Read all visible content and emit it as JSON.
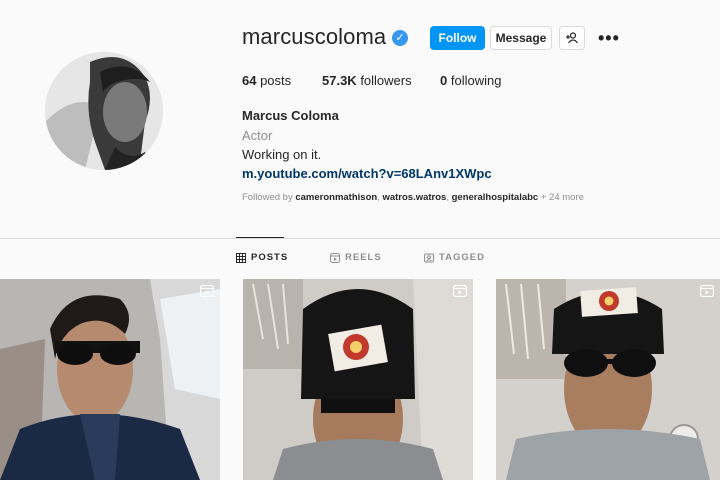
{
  "profile": {
    "username": "marcuscoloma",
    "verified": true,
    "actions": {
      "follow": "Follow",
      "message": "Message",
      "suggest": "+",
      "more": "•••"
    },
    "stats": [
      {
        "value": "64",
        "label": " posts"
      },
      {
        "value": "57.3K",
        "label": " followers"
      },
      {
        "value": "0",
        "label": " following"
      }
    ],
    "full_name": "Marcus Coloma",
    "category": "Actor",
    "bio": "Working on it.",
    "link": "m.youtube.com/watch?v=68LAnv1XWpc",
    "followed_by": {
      "prefix": "Followed by ",
      "names": [
        "cameronmathison",
        "watros.watros",
        "generalhospitalabc"
      ],
      "suffix": " + 24 more"
    }
  },
  "tabs": [
    {
      "label": "POSTS",
      "icon": "grid-icon",
      "active": true
    },
    {
      "label": "REELS",
      "icon": "reels-icon",
      "active": false
    },
    {
      "label": "TAGGED",
      "icon": "tag-icon",
      "active": false
    }
  ],
  "colors": {
    "accent": "#0095f6",
    "link": "#00376b",
    "muted": "#8e8e8e",
    "verified": "#3897f0"
  }
}
